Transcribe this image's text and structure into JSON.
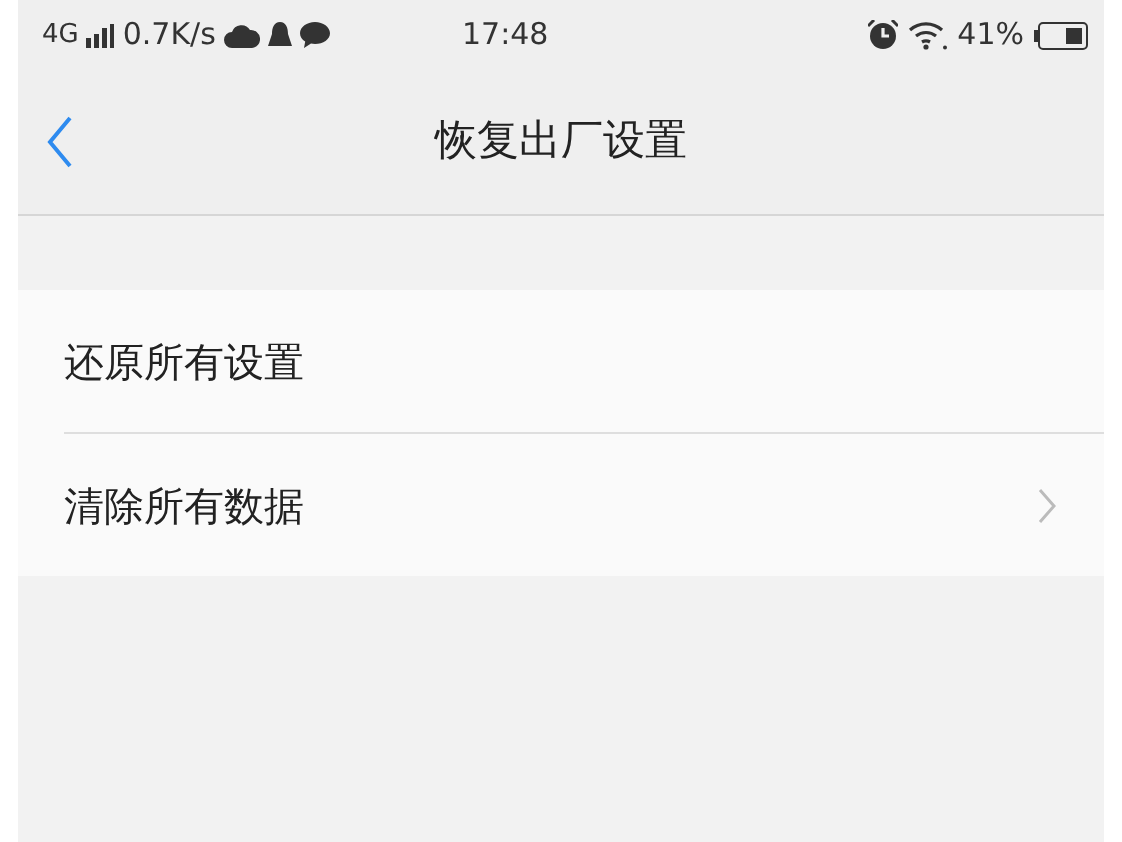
{
  "status_bar": {
    "network": "4G",
    "speed": "0.7K/s",
    "time": "17:48",
    "battery": "41%"
  },
  "nav": {
    "title": "恢复出厂设置"
  },
  "items": [
    {
      "label": "还原所有设置",
      "chevron": false
    },
    {
      "label": "清除所有数据",
      "chevron": true
    }
  ]
}
